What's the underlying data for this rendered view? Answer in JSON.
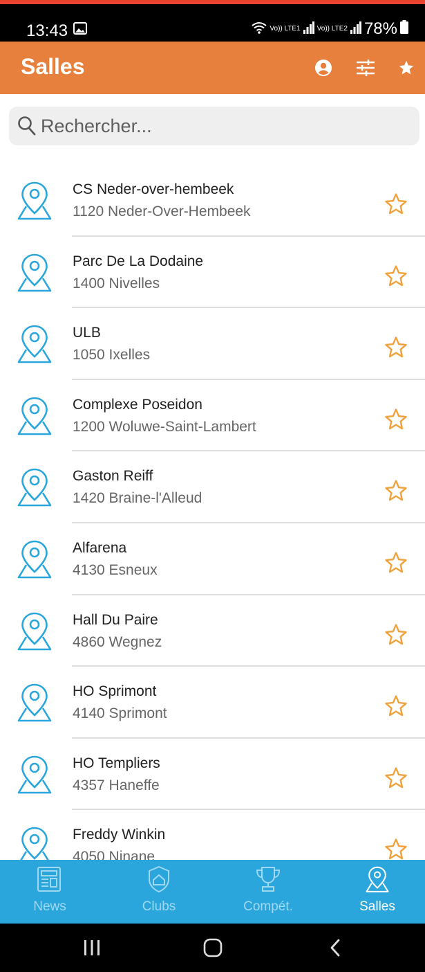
{
  "status": {
    "time": "13:43",
    "net1": "Vo)) LTE1",
    "net2": "Vo)) LTE2",
    "battery": "78%"
  },
  "app_bar": {
    "title": "Salles",
    "icons": [
      "account-circle-icon",
      "tune-icon",
      "star-filled-icon"
    ]
  },
  "search": {
    "placeholder": "Rechercher..."
  },
  "venues": [
    {
      "name": "CS Neder-over-hembeek",
      "address": "1120 Neder-Over-Hembeek"
    },
    {
      "name": "Parc De La Dodaine",
      "address": "1400 Nivelles"
    },
    {
      "name": "ULB",
      "address": "1050 Ixelles"
    },
    {
      "name": "Complexe Poseidon",
      "address": "1200 Woluwe-Saint-Lambert"
    },
    {
      "name": "Gaston Reiff",
      "address": "1420 Braine-l'Alleud"
    },
    {
      "name": "Alfarena",
      "address": "4130 Esneux"
    },
    {
      "name": "Hall Du Paire",
      "address": "4860 Wegnez"
    },
    {
      "name": "HO Sprimont",
      "address": "4140 Sprimont"
    },
    {
      "name": "HO Templiers",
      "address": "4357 Haneffe"
    },
    {
      "name": "Freddy Winkin",
      "address": "4050 Ninane"
    }
  ],
  "bottom_nav": [
    {
      "label": "News",
      "icon": "newspaper-icon",
      "active": false
    },
    {
      "label": "Clubs",
      "icon": "shield-home-icon",
      "active": false
    },
    {
      "label": "Compét.",
      "icon": "trophy-icon",
      "active": false
    },
    {
      "label": "Salles",
      "icon": "map-pin-icon",
      "active": true
    }
  ],
  "colors": {
    "app_bar": "#e8803d",
    "accent_star": "#f0a13a",
    "pin_blue": "#2aa6dc",
    "bottom_nav": "#2aa6dc"
  }
}
